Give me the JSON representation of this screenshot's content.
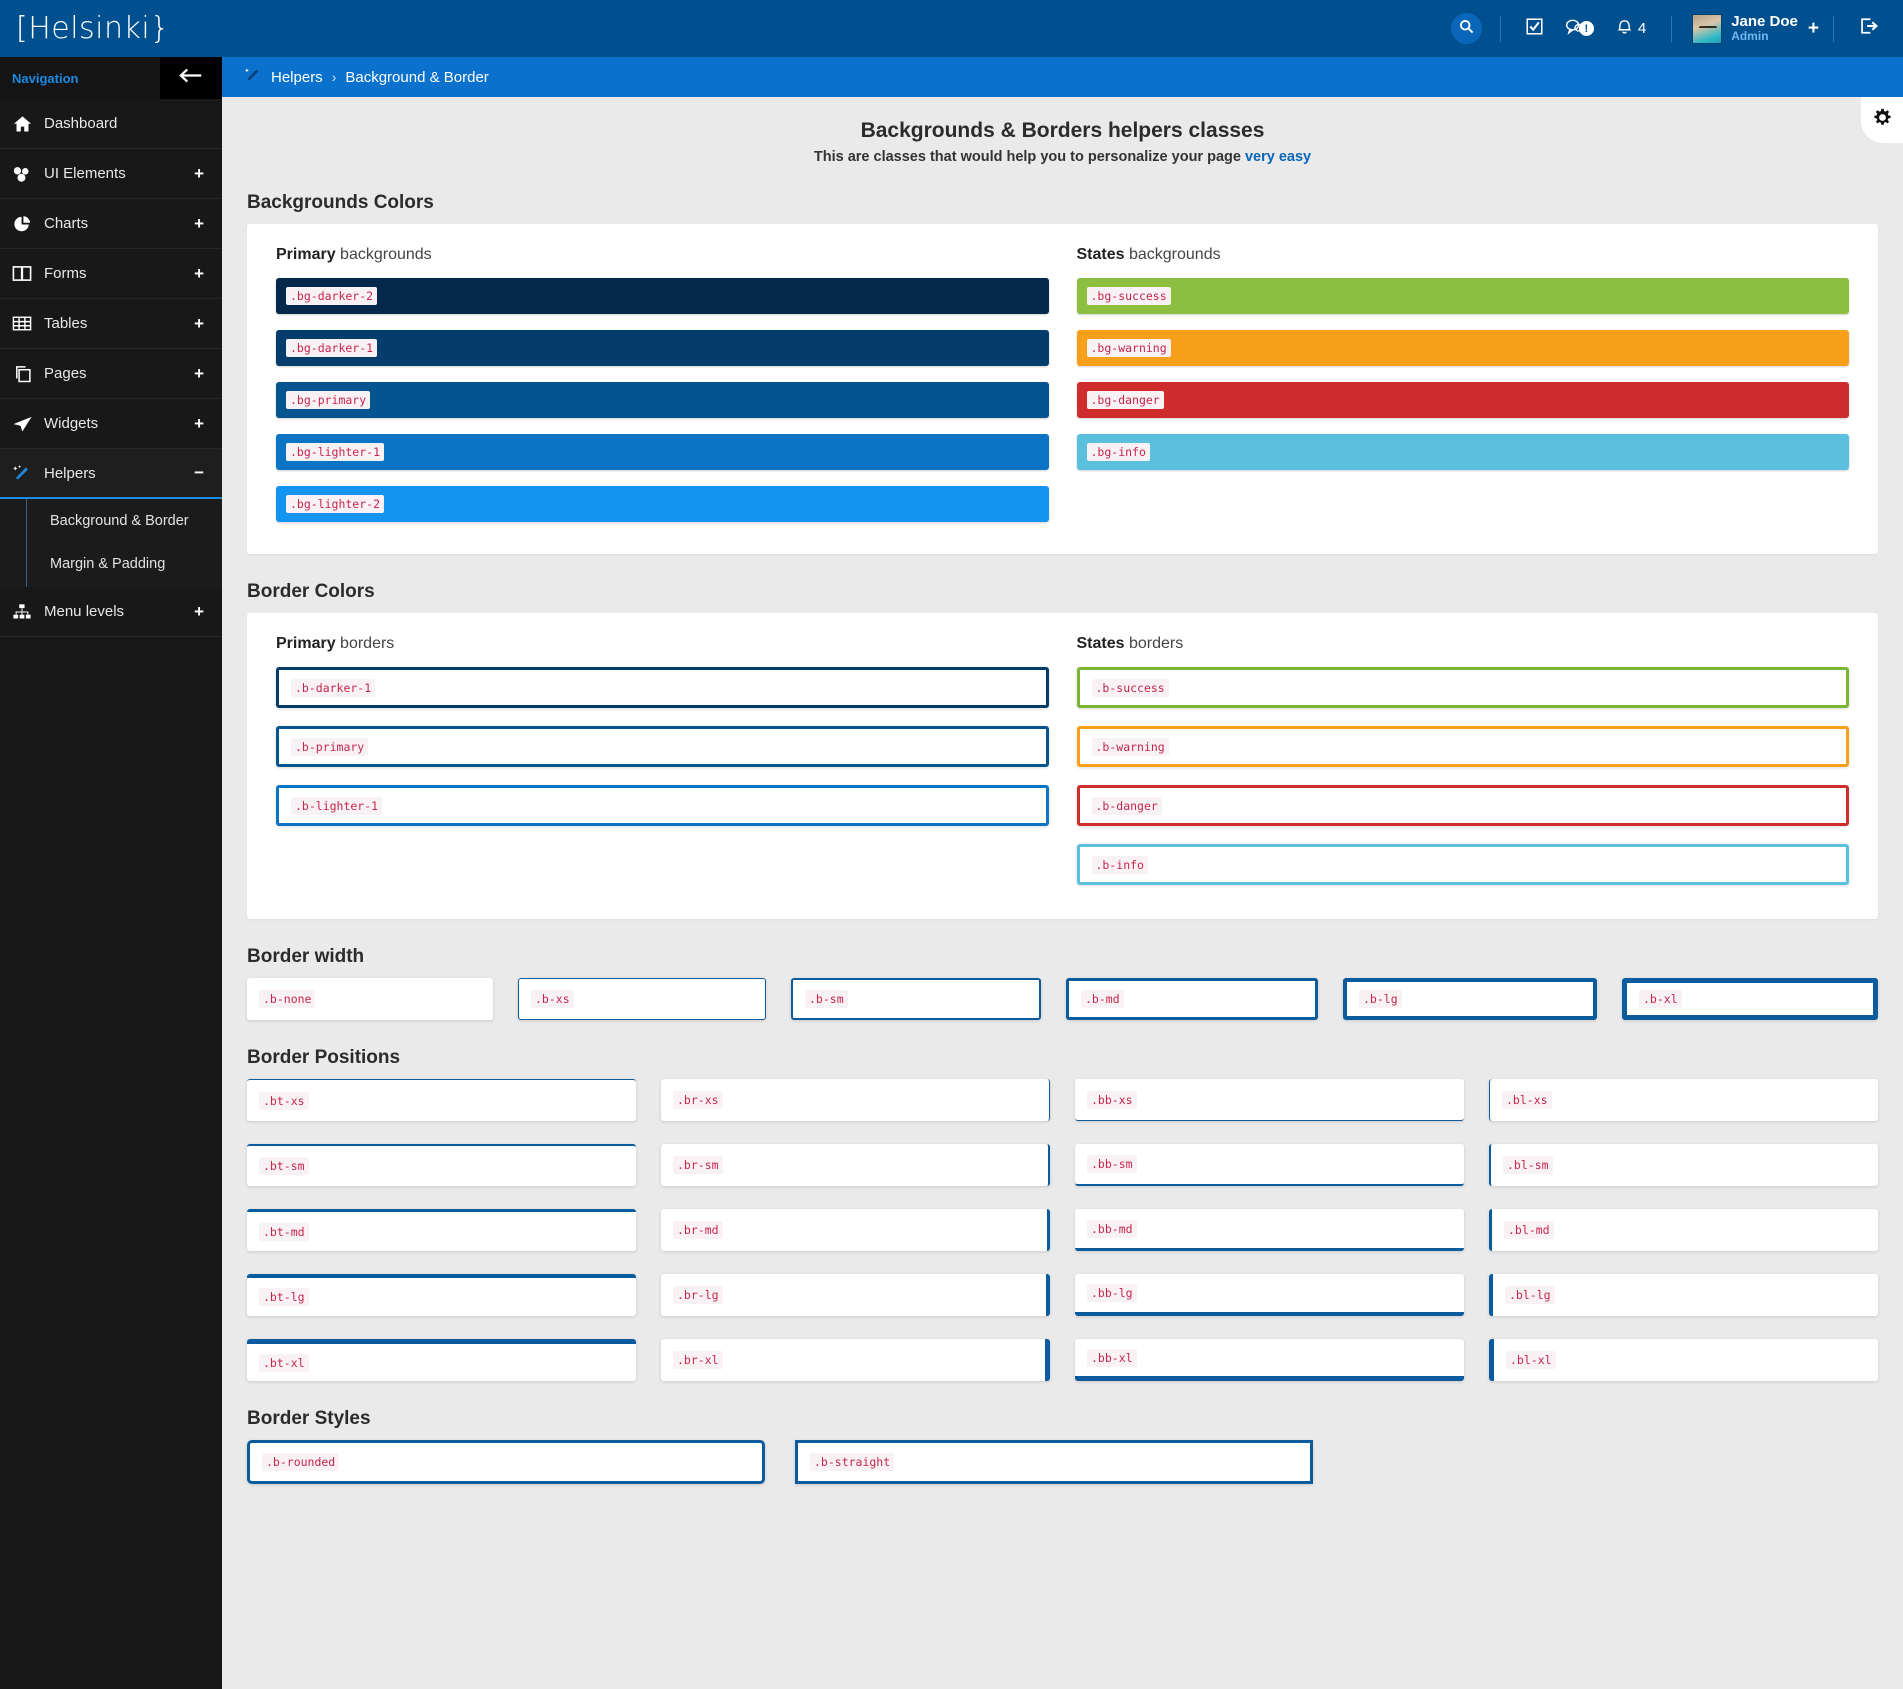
{
  "brand": {
    "name": "[Helsinki}"
  },
  "topbar": {
    "search_label": "search-icon",
    "tasks_label": "tasks-icon",
    "messages_label": "messages-icon",
    "alerts_label": "alerts-icon",
    "alert_badge": "!",
    "bell_count": "4",
    "user_name": "Jane Doe",
    "user_role": "Admin",
    "user_plus": "+"
  },
  "sidebar": {
    "nav_label": "Navigation",
    "items": [
      {
        "label": "Dashboard",
        "icon": "home-icon",
        "expand": ""
      },
      {
        "label": "UI Elements",
        "icon": "cubes-icon",
        "expand": "+"
      },
      {
        "label": "Charts",
        "icon": "pie-chart-icon",
        "expand": "+"
      },
      {
        "label": "Forms",
        "icon": "columns-icon",
        "expand": "+"
      },
      {
        "label": "Tables",
        "icon": "table-icon",
        "expand": "+"
      },
      {
        "label": "Pages",
        "icon": "pages-icon",
        "expand": "+"
      },
      {
        "label": "Widgets",
        "icon": "send-icon",
        "expand": "+"
      },
      {
        "label": "Helpers",
        "icon": "magic-wand-icon",
        "expand": "−"
      },
      {
        "label": "Menu levels",
        "icon": "sitemap-icon",
        "expand": "+"
      }
    ],
    "sub_items": [
      {
        "label": "Background & Border"
      },
      {
        "label": "Margin & Padding"
      }
    ]
  },
  "breadcrumb": {
    "root": "Helpers",
    "separator": "›",
    "current": "Background & Border"
  },
  "page": {
    "title": "Backgrounds & Borders helpers classes",
    "subtitle_prefix": "This are classes that would help you to personalize your page ",
    "subtitle_highlight": "very easy"
  },
  "sections": {
    "backgrounds": {
      "title": "Backgrounds Colors",
      "primary_head_bold": "Primary",
      "primary_head_rest": " backgrounds",
      "states_head_bold": "States",
      "states_head_rest": " backgrounds",
      "primary": [
        {
          "label": ".bg-darker-2",
          "color": "#05294a"
        },
        {
          "label": ".bg-darker-1",
          "color": "#043c6b"
        },
        {
          "label": ".bg-primary",
          "color": "#04558f"
        },
        {
          "label": ".bg-lighter-1",
          "color": "#0b74c4"
        },
        {
          "label": ".bg-lighter-2",
          "color": "#1593f0"
        }
      ],
      "states": [
        {
          "label": ".bg-success",
          "color": "#8cbf40"
        },
        {
          "label": ".bg-warning",
          "color": "#f9a01b"
        },
        {
          "label": ".bg-danger",
          "color": "#cf2d2d"
        },
        {
          "label": ".bg-info",
          "color": "#5bc0de"
        }
      ]
    },
    "border_colors": {
      "title": "Border Colors",
      "primary_head_bold": "Primary",
      "primary_head_rest": " borders",
      "states_head_bold": "States",
      "states_head_rest": " borders",
      "primary": [
        {
          "label": ".b-darker-1",
          "color": "#043c6b"
        },
        {
          "label": ".b-primary",
          "color": "#04558f"
        },
        {
          "label": ".b-lighter-1",
          "color": "#0b74c4"
        }
      ],
      "states": [
        {
          "label": ".b-success",
          "color": "#7ab533"
        },
        {
          "label": ".b-warning",
          "color": "#f9a01b"
        },
        {
          "label": ".b-danger",
          "color": "#cf2d2d"
        },
        {
          "label": ".b-info",
          "color": "#5bc0de"
        }
      ]
    },
    "border_width": {
      "title": "Border width",
      "items": [
        {
          "label": ".b-none",
          "width": 0
        },
        {
          "label": ".b-xs",
          "width": 1
        },
        {
          "label": ".b-sm",
          "width": 2
        },
        {
          "label": ".b-md",
          "width": 3
        },
        {
          "label": ".b-lg",
          "width": 4
        },
        {
          "label": ".b-xl",
          "width": 5
        }
      ]
    },
    "border_positions": {
      "title": "Border Positions",
      "rows": [
        [
          {
            "label": ".bt-xs",
            "side": "top",
            "width": 1
          },
          {
            "label": ".br-xs",
            "side": "right",
            "width": 1
          },
          {
            "label": ".bb-xs",
            "side": "bottom",
            "width": 1
          },
          {
            "label": ".bl-xs",
            "side": "left",
            "width": 1
          }
        ],
        [
          {
            "label": ".bt-sm",
            "side": "top",
            "width": 2
          },
          {
            "label": ".br-sm",
            "side": "right",
            "width": 2
          },
          {
            "label": ".bb-sm",
            "side": "bottom",
            "width": 2
          },
          {
            "label": ".bl-sm",
            "side": "left",
            "width": 2
          }
        ],
        [
          {
            "label": ".bt-md",
            "side": "top",
            "width": 3
          },
          {
            "label": ".br-md",
            "side": "right",
            "width": 3
          },
          {
            "label": ".bb-md",
            "side": "bottom",
            "width": 3
          },
          {
            "label": ".bl-md",
            "side": "left",
            "width": 3
          }
        ],
        [
          {
            "label": ".bt-lg",
            "side": "top",
            "width": 4
          },
          {
            "label": ".br-lg",
            "side": "right",
            "width": 4
          },
          {
            "label": ".bb-lg",
            "side": "bottom",
            "width": 4
          },
          {
            "label": ".bl-lg",
            "side": "left",
            "width": 4
          }
        ],
        [
          {
            "label": ".bt-xl",
            "side": "top",
            "width": 5
          },
          {
            "label": ".br-xl",
            "side": "right",
            "width": 5
          },
          {
            "label": ".bb-xl",
            "side": "bottom",
            "width": 5
          },
          {
            "label": ".bl-xl",
            "side": "left",
            "width": 5
          }
        ]
      ]
    },
    "border_styles": {
      "title": "Border Styles",
      "items": [
        {
          "label": ".b-rounded",
          "radius": 5
        },
        {
          "label": ".b-straight",
          "radius": 0
        }
      ]
    }
  },
  "colors": {
    "brand_blue": "#00508f",
    "crumb_blue": "#0a72cd",
    "accent": "#1a8ae5",
    "border_default": "#0b5c9e",
    "code_text": "#c7254e",
    "page_bg": "#eaeaea"
  }
}
